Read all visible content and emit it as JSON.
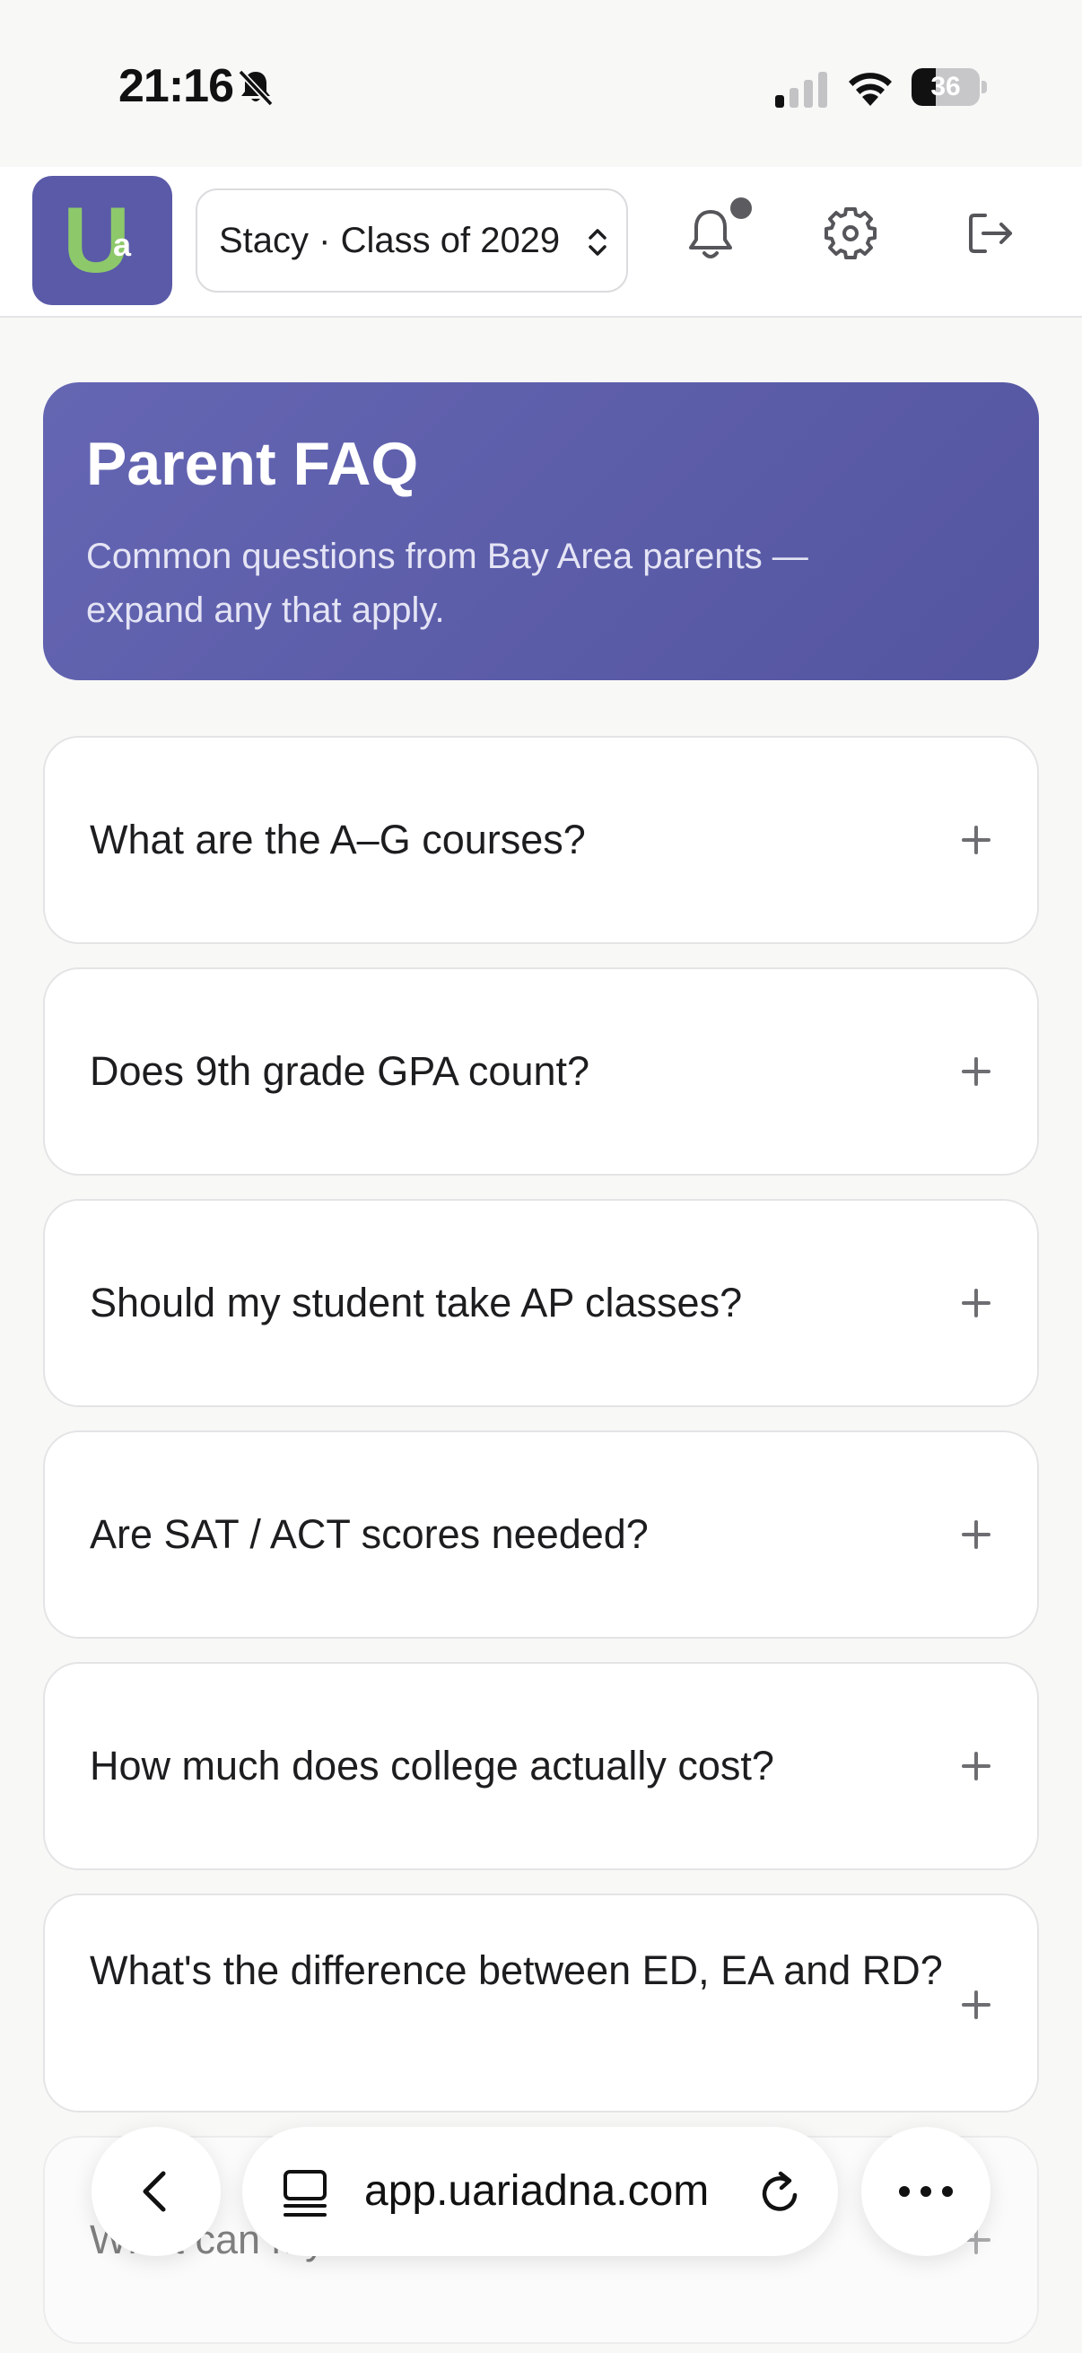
{
  "status_bar": {
    "time": "21:16",
    "battery": "36",
    "battery_level": 0.36
  },
  "header": {
    "student_select_value": "Stacy · Class of 2029",
    "has_unread_notifications": true
  },
  "hero": {
    "title": "Parent FAQ",
    "subtitle": "Common questions from Bay Area parents — expand any that apply."
  },
  "faq": [
    {
      "question": "What are the A–G courses?"
    },
    {
      "question": "Does 9th grade GPA count?"
    },
    {
      "question": "Should my student take AP classes?"
    },
    {
      "question": "Are SAT / ACT scores needed?"
    },
    {
      "question": "How much does college actually cost?"
    },
    {
      "question": "What's the difference between ED, EA and RD?"
    },
    {
      "question": "What can my student do this summer?"
    }
  ],
  "browser": {
    "url": "app.uariadna.com"
  },
  "colors": {
    "accent": "#5a5aa8",
    "logo_green": "#8dc96b",
    "background": "#f8f8f7"
  },
  "icons": [
    "silent-mode-icon",
    "cellular-signal-icon",
    "wifi-icon",
    "battery-icon",
    "chevron-updown-icon",
    "bell-icon",
    "gear-icon",
    "logout-icon",
    "plus-icon",
    "back-chevron-icon",
    "tabs-icon",
    "reload-icon",
    "more-icon"
  ]
}
